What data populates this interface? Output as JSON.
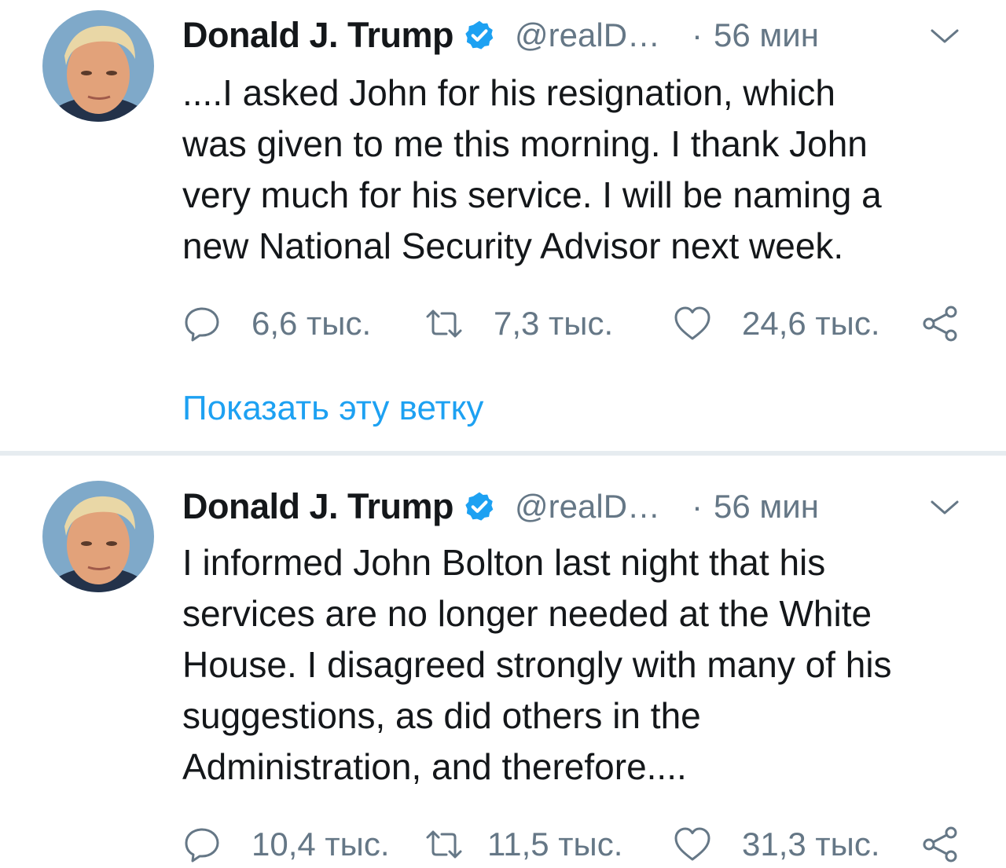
{
  "colors": {
    "text": "#14171a",
    "secondary": "#657786",
    "link": "#1da1f2",
    "verified": "#1da1f2",
    "separator": "#e6ecf0"
  },
  "tweets": [
    {
      "display_name": "Donald J. Trump",
      "handle": "@realD…",
      "dot": "·",
      "time": "56 мин",
      "lines": [
        "....I asked John for his resignation, which",
        "was given to me this morning. I thank John",
        "very much for his service. I will be naming a",
        "new National Security Advisor next week."
      ],
      "replies": "6,6 тыс.",
      "retweets": "7,3 тыс.",
      "likes": "24,6 тыс.",
      "show_thread": "Показать эту ветку"
    },
    {
      "display_name": "Donald J. Trump",
      "handle": "@realD…",
      "dot": "·",
      "time": "56 мин",
      "lines": [
        "I informed John Bolton last night that his",
        "services are no longer needed at the White",
        "House. I disagreed strongly with many of his",
        "suggestions, as did others in the",
        "Administration, and therefore...."
      ],
      "replies": "10,4 тыс.",
      "retweets": "11,5 тыс.",
      "likes": "31,3 тыс."
    }
  ],
  "icons": {
    "avatar": "profile-photo",
    "verified": "verified-badge-icon",
    "caret": "chevron-down-icon",
    "reply": "reply-icon",
    "retweet": "retweet-icon",
    "like": "heart-icon",
    "share": "share-icon"
  }
}
